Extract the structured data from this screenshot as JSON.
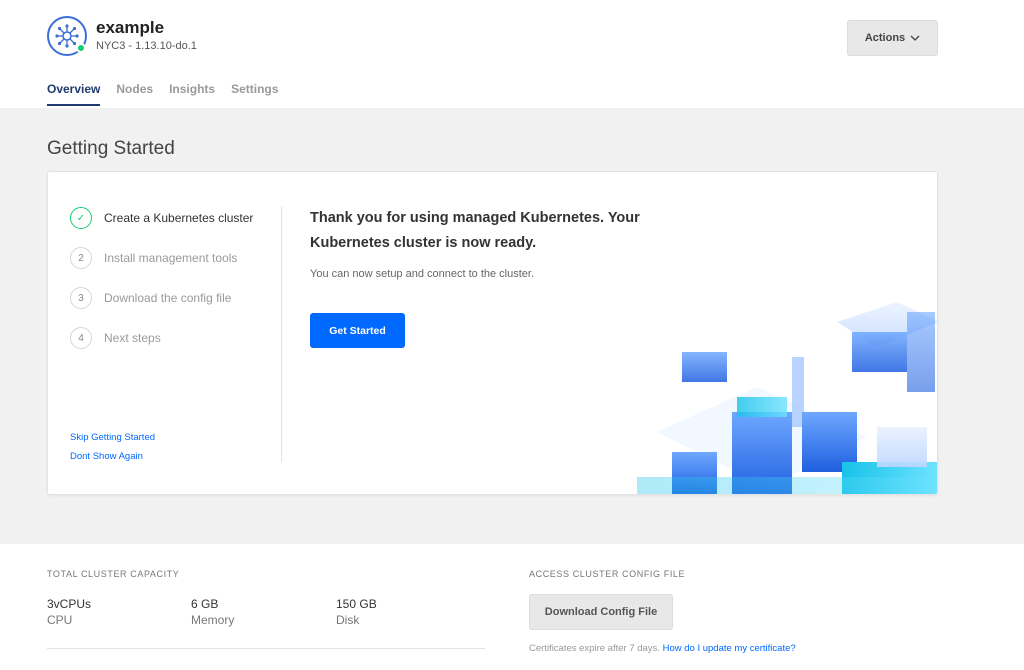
{
  "cluster": {
    "name": "example",
    "subtitle": "NYC3 - 1.13.10-do.1",
    "status_color": "#15cd72",
    "avatar_icon": "kubernetes-icon"
  },
  "header": {
    "actions_label": "Actions",
    "actions_icon": "chevron-down-icon"
  },
  "tabs": [
    {
      "label": "Overview",
      "active": true
    },
    {
      "label": "Nodes",
      "active": false
    },
    {
      "label": "Insights",
      "active": false
    },
    {
      "label": "Settings",
      "active": false
    }
  ],
  "getting_started": {
    "title": "Getting Started",
    "steps": [
      {
        "marker": "✓",
        "label": "Create a Kubernetes cluster",
        "state": "done"
      },
      {
        "marker": "2",
        "label": "Install management tools",
        "state": "pending"
      },
      {
        "marker": "3",
        "label": "Download the config file",
        "state": "pending"
      },
      {
        "marker": "4",
        "label": "Next steps",
        "state": "pending"
      }
    ],
    "skip_label": "Skip Getting Started",
    "dont_show_label": "Dont Show Again",
    "headline": "Thank you for using managed Kubernetes. Your Kubernetes cluster is now ready.",
    "subcopy": "You can now setup and connect to the cluster.",
    "cta_label": "Get Started"
  },
  "capacity": {
    "title": "TOTAL CLUSTER CAPACITY",
    "items": [
      {
        "value": "3vCPUs",
        "label": "CPU"
      },
      {
        "value": "6 GB",
        "label": "Memory"
      },
      {
        "value": "150 GB",
        "label": "Disk"
      }
    ]
  },
  "access": {
    "title": "ACCESS CLUSTER CONFIG FILE",
    "download_label": "Download Config File",
    "cert_note": "Certificates expire after 7 days.",
    "cert_link": "How do I update my certificate?"
  },
  "colors": {
    "accent": "#0069ff",
    "nav_active": "#1f3a6e",
    "success": "#15cd72"
  }
}
